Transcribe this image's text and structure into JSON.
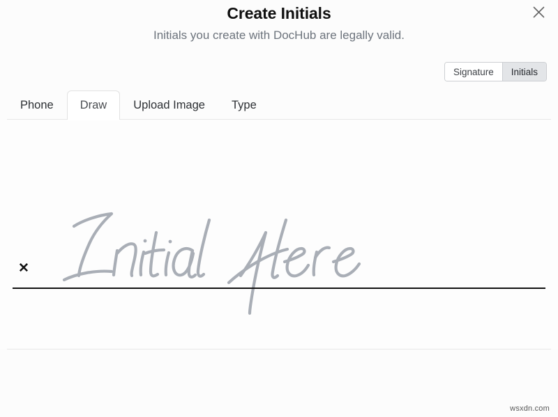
{
  "modal": {
    "title": "Create Initials",
    "subtitle": "Initials you create with DocHub are legally valid.",
    "close_label": "×"
  },
  "segmented_control": {
    "options": [
      {
        "label": "Signature",
        "selected": false
      },
      {
        "label": "Initials",
        "selected": true
      }
    ]
  },
  "tabs": [
    {
      "label": "Phone",
      "active": false
    },
    {
      "label": "Draw",
      "active": true
    },
    {
      "label": "Upload Image",
      "active": false
    },
    {
      "label": "Type",
      "active": false
    }
  ],
  "draw_panel": {
    "x_mark": "✕",
    "placeholder_script": "Initial Here",
    "placeholder_word_1": "Initial",
    "placeholder_word_2": "Here"
  },
  "footer": {
    "watermark": "wsxdn.com"
  },
  "colors": {
    "page_background": "#fcfcfc",
    "title_text": "#0f0f0f",
    "subtitle_text": "#6c737c",
    "tab_text": "#2c2f33",
    "active_tab_background": "#ffffff",
    "tab_border": "#e2e2e2",
    "segment_active_background": "#e3e5e8",
    "segment_border": "#ccced2",
    "signature_line": "#111111",
    "placeholder_script": "#a9aeb6",
    "divider": "#e8e8e8",
    "watermark_text": "#585858"
  }
}
